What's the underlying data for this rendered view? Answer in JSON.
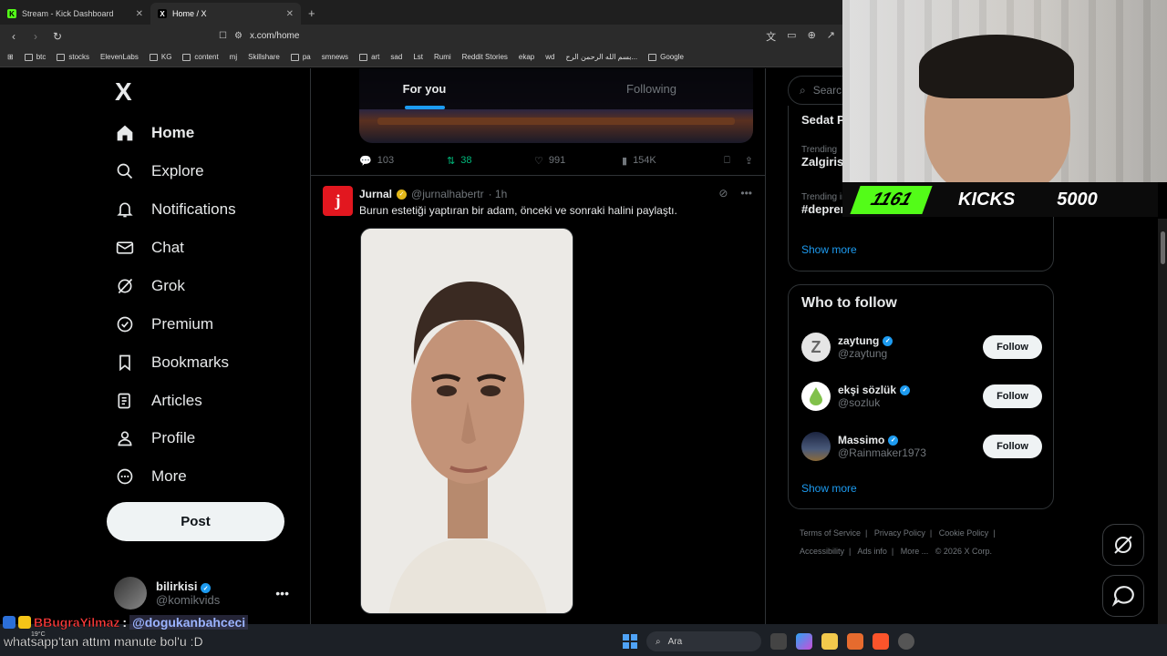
{
  "browser": {
    "tabs": [
      {
        "title": "Stream - Kick Dashboard",
        "favicon": "K",
        "active": false
      },
      {
        "title": "Home / X",
        "favicon": "X",
        "active": true
      }
    ],
    "url": "x.com/home",
    "bookmarks": [
      "btc",
      "stocks",
      "ElevenLabs",
      "KG",
      "content",
      "mj",
      "Skillshare",
      "pa",
      "smnews",
      "art",
      "sad",
      "Lst",
      "Rumi",
      "Reddit Stories",
      "ekap",
      "wd",
      "بسم الله الرحمن الرح...",
      "Google"
    ]
  },
  "sidebar": {
    "logo": "X",
    "items": [
      {
        "label": "Home",
        "icon": "home-icon",
        "bold": true
      },
      {
        "label": "Explore",
        "icon": "search-icon"
      },
      {
        "label": "Notifications",
        "icon": "bell-icon"
      },
      {
        "label": "Chat",
        "icon": "mail-icon"
      },
      {
        "label": "Grok",
        "icon": "grok-icon"
      },
      {
        "label": "Premium",
        "icon": "premium-icon"
      },
      {
        "label": "Bookmarks",
        "icon": "bookmark-icon"
      },
      {
        "label": "Articles",
        "icon": "articles-icon"
      },
      {
        "label": "Profile",
        "icon": "person-icon"
      },
      {
        "label": "More",
        "icon": "more-circle-icon"
      }
    ],
    "post_label": "Post",
    "account": {
      "name": "bilirkisi",
      "handle": "@komikvids"
    }
  },
  "feed": {
    "tabs": [
      {
        "label": "For you",
        "active": true
      },
      {
        "label": "Following",
        "active": false
      }
    ],
    "prev_actions": {
      "replies": "103",
      "reposts": "38",
      "likes": "991",
      "views": "154K"
    },
    "tweet": {
      "avatar_letter": "j",
      "name": "Jurnal",
      "handle": "@jurnalhabertr",
      "time": "· 1h",
      "text": "Burun estetiği yaptıran bir adam, önceki ve sonraki halini paylaştı."
    }
  },
  "right": {
    "search_placeholder": "Searc",
    "trends": [
      {
        "meta": "",
        "title": "Sedat P"
      },
      {
        "meta": "Trending",
        "title": "Zalgiris"
      },
      {
        "meta": "Trending in Tu",
        "title": "#deprem"
      }
    ],
    "show_more": "Show more",
    "who_to_follow": {
      "title": "Who to follow",
      "accounts": [
        {
          "name": "zaytung",
          "handle": "@zaytung",
          "avatar": "Z"
        },
        {
          "name": "ekşi sözlük",
          "handle": "@sozluk",
          "avatar": ""
        },
        {
          "name": "Massimo",
          "handle": "@Rainmaker1973",
          "avatar": ""
        }
      ],
      "follow_label": "Follow",
      "show_more": "Show more"
    },
    "footer_links": [
      "Terms of Service",
      "|",
      "Privacy Policy",
      "|",
      "Cookie Policy",
      "|",
      "Accessibility",
      "|",
      "Ads info",
      "|",
      "More ...",
      "© 2026 X Corp."
    ]
  },
  "stream_overlay": {
    "kicks_count": "1161",
    "kicks_label": "KICKS",
    "kicks_goal": "5000",
    "chat_user": "BBugraYilmaz",
    "chat_sep": ":",
    "chat_mention": "@dogukanbahceci",
    "chat_message": "whatsapp'tan attım manute bol'u :D",
    "weather": "19°C"
  },
  "taskbar": {
    "search_label": "Ara"
  },
  "colors": {
    "accent": "#1d9bf0",
    "kick_green": "#53fc18",
    "repost_green": "#00ba7c"
  }
}
